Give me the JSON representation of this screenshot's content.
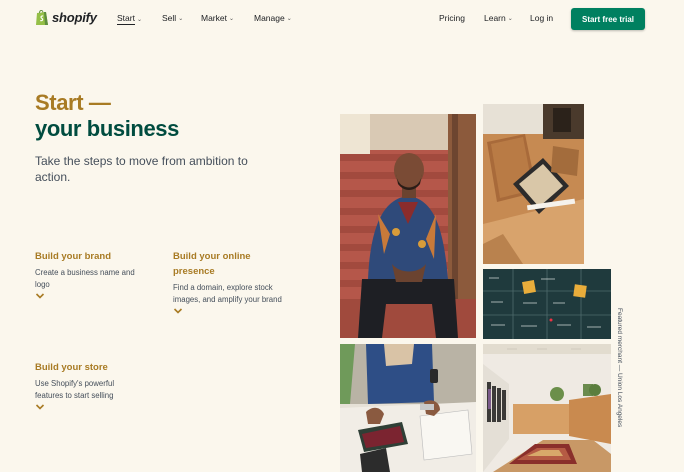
{
  "brand": {
    "name": "shopify",
    "color": "#95bf47"
  },
  "nav": {
    "items": [
      {
        "label": "Start",
        "has_dropdown": true,
        "active": true
      },
      {
        "label": "Sell",
        "has_dropdown": true
      },
      {
        "label": "Market",
        "has_dropdown": true
      },
      {
        "label": "Manage",
        "has_dropdown": true
      }
    ],
    "right": [
      {
        "label": "Pricing"
      },
      {
        "label": "Learn",
        "has_dropdown": true
      },
      {
        "label": "Log in"
      }
    ],
    "cta_label": "Start free trial"
  },
  "hero": {
    "title_line1": "Start —",
    "title_line2": "your business",
    "subtitle": "Take the steps to move from ambition to action."
  },
  "features": [
    {
      "title": "Build your brand",
      "description": "Create a business name and logo"
    },
    {
      "title": "Build your online presence",
      "description": "Find a domain, explore stock images, and amplify your brand"
    },
    {
      "title": "Build your store",
      "description": "Use Shopify's powerful features to start selling"
    }
  ],
  "caption": "Featured merchant — Union Los Angeles",
  "colors": {
    "accent": "#008060",
    "gold": "#a87b24",
    "dark_green": "#004c3f",
    "background": "#fbf7ed"
  }
}
